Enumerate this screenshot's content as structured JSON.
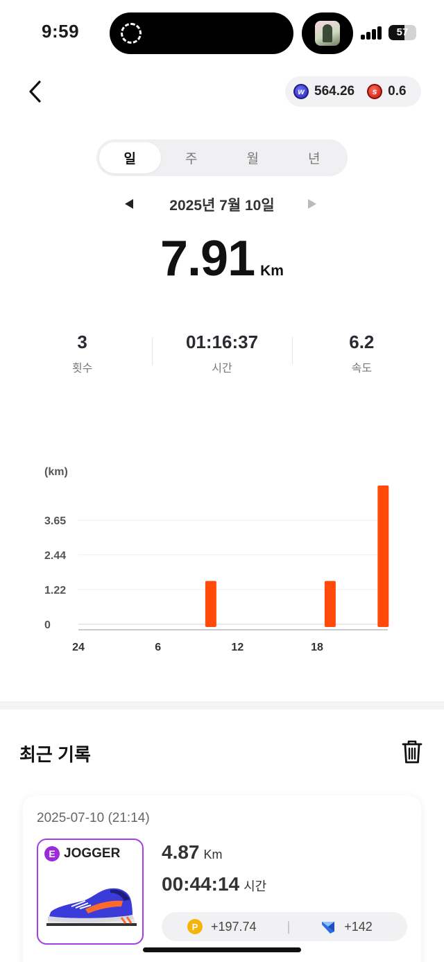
{
  "status_bar": {
    "time": "9:59",
    "battery": "57",
    "battery_level": 0.57
  },
  "header": {
    "wallet": [
      {
        "icon": "w-token-icon",
        "value": "564.26",
        "color": "#3434c4"
      },
      {
        "icon": "s-token-icon",
        "value": "0.6",
        "color": "#d81e10"
      }
    ]
  },
  "tabs": [
    {
      "label": "일",
      "active": true
    },
    {
      "label": "주",
      "active": false
    },
    {
      "label": "월",
      "active": false
    },
    {
      "label": "년",
      "active": false
    }
  ],
  "date_nav": {
    "label": "2025년 7월 10일"
  },
  "summary": {
    "distance": "7.91",
    "unit": "Km"
  },
  "stats": [
    {
      "value": "3",
      "label": "횟수"
    },
    {
      "value": "01:16:37",
      "label": "시간"
    },
    {
      "value": "6.2",
      "label": "속도"
    }
  ],
  "chart_data": {
    "type": "bar",
    "ylabel": "(km)",
    "y_ticks": [
      "3.65",
      "2.44",
      "1.22",
      "0"
    ],
    "ylim": [
      0,
      4.87
    ],
    "x_ticks": [
      "24",
      "6",
      "12",
      "18"
    ],
    "x_range_hours": [
      0,
      24
    ],
    "bar_color": "#ff4a0a",
    "bars": [
      {
        "hour": 8,
        "value": 1.52
      },
      {
        "hour": 17,
        "value": 1.52
      },
      {
        "hour": 21,
        "value": 4.87
      }
    ],
    "grid": true
  },
  "recent": {
    "title": "최근 기록",
    "records": [
      {
        "datetime": "2025-07-10 (21:14)",
        "grade_letter": "E",
        "grade": "JOGGER",
        "distance": "4.87",
        "distance_unit": "Km",
        "duration": "00:44:14",
        "duration_unit": "시간",
        "reward_points": "+197.74",
        "reward_points_icon": "p-coin-icon",
        "reward_gems": "+142",
        "reward_gems_icon": "gem-icon",
        "accent": "#a23de8"
      }
    ]
  }
}
